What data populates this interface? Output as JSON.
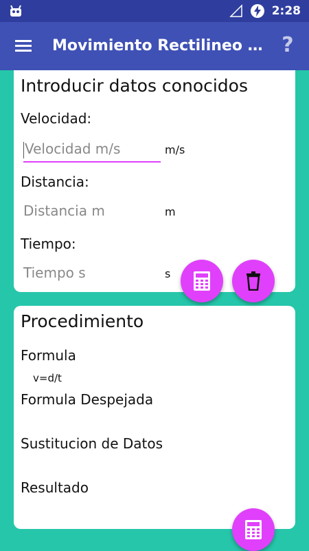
{
  "statusbar": {
    "time": "2:28",
    "icons": [
      "android-debug-icon",
      "signal-icon",
      "battery-charging-icon"
    ]
  },
  "appbar": {
    "title": "Movimiento Rectilineo Uniforme",
    "menu_icon": "hamburger-menu-icon",
    "help_label": "?"
  },
  "known_data": {
    "heading": "Introducir datos conocidos",
    "velocity": {
      "label": "Velocidad:",
      "placeholder": "Velocidad m/s",
      "unit": "m/s"
    },
    "distance": {
      "label": "Distancia:",
      "placeholder": "Distancia m",
      "unit": "m"
    },
    "time": {
      "label": "Tiempo:",
      "placeholder": "Tiempo s",
      "unit": "s"
    }
  },
  "procedure": {
    "heading": "Procedimiento",
    "formula_label": "Formula",
    "formula_value": "v=d/t",
    "solved_formula_label": "Formula Despejada",
    "substitution_label": "Sustitucion de Datos",
    "result_label": "Resultado"
  },
  "colors": {
    "primary": "#3F51B5",
    "primary_dark": "#2F3E9E",
    "accent": "#E040FB",
    "background": "#26C6AA"
  }
}
